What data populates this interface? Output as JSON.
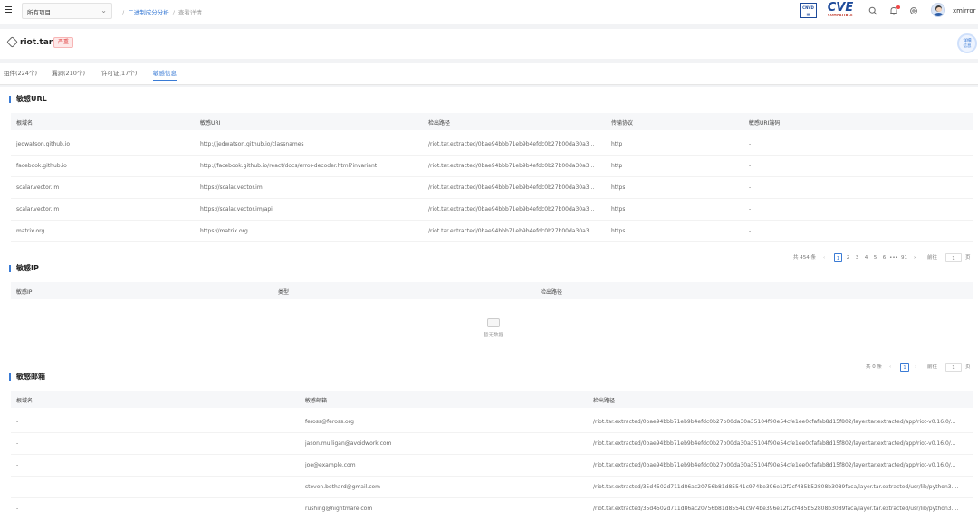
{
  "topbar": {
    "project_select": "所有项目",
    "breadcrumb": [
      "二进制成分分析",
      "查看详情"
    ],
    "logo_cnvd_text": "CNVD",
    "logo_cve_text": "CVE",
    "logo_cve_sub": "COMPATIBLE",
    "username": "xmirror"
  },
  "header": {
    "package_name": "riot.tar",
    "severity": "严重",
    "detail_button": [
      "详细",
      "信息"
    ]
  },
  "tabs": [
    {
      "label": "组件(224个)",
      "active": false
    },
    {
      "label": "漏洞(210个)",
      "active": false
    },
    {
      "label": "许可证(17个)",
      "active": false
    },
    {
      "label": "敏感信息",
      "active": true
    }
  ],
  "sensitive_url": {
    "title": "敏感URL",
    "columns": [
      "根域名",
      "敏感URI",
      "检出路径",
      "传输协议",
      "敏感URI端码"
    ],
    "rows": [
      [
        "jedwatson.github.io",
        "http://jedwatson.github.io/classnames",
        "/riot.tar.extracted/0bae94bbb71eb9b4efdc0b27b00da30a3...",
        "http",
        "-"
      ],
      [
        "facebook.github.io",
        "http://facebook.github.io/react/docs/error-decoder.html?invariant",
        "/riot.tar.extracted/0bae94bbb71eb9b4efdc0b27b00da30a3...",
        "http",
        "-"
      ],
      [
        "scalar.vector.im",
        "https://scalar.vector.im",
        "/riot.tar.extracted/0bae94bbb71eb9b4efdc0b27b00da30a3...",
        "https",
        "-"
      ],
      [
        "scalar.vector.im",
        "https://scalar.vector.im/api",
        "/riot.tar.extracted/0bae94bbb71eb9b4efdc0b27b00da30a3...",
        "https",
        "-"
      ],
      [
        "matrix.org",
        "https://matrix.org",
        "/riot.tar.extracted/0bae94bbb71eb9b4efdc0b27b00da30a3...",
        "https",
        "-"
      ]
    ],
    "pager": {
      "total": "共 454 条",
      "pages": [
        "1",
        "2",
        "3",
        "4",
        "5",
        "6",
        "•••",
        "91"
      ],
      "goto_label": "前往",
      "goto_value": "1",
      "page_unit": "页"
    }
  },
  "sensitive_ip": {
    "title": "敏感IP",
    "columns": [
      "敏感IP",
      "类型",
      "检出路径"
    ],
    "empty_text": "暂无数据",
    "pager": {
      "total": "共 0 条",
      "current": "1",
      "goto_label": "前往",
      "goto_value": "1",
      "page_unit": "页"
    }
  },
  "sensitive_email": {
    "title": "敏感邮箱",
    "columns": [
      "根域名",
      "敏感邮箱",
      "检出路径"
    ],
    "rows": [
      [
        "-",
        "feross@feross.org",
        "/riot.tar.extracted/0bae94bbb71eb9b4efdc0b27b00da30a35104f90e54cfe1ee0cfafab8d15f802/layer.tar.extracted/app/riot-v0.16.0/..."
      ],
      [
        "-",
        "jason.mulligan@avoidwork.com",
        "/riot.tar.extracted/0bae94bbb71eb9b4efdc0b27b00da30a35104f90e54cfe1ee0cfafab8d15f802/layer.tar.extracted/app/riot-v0.16.0/..."
      ],
      [
        "-",
        "joe@example.com",
        "/riot.tar.extracted/0bae94bbb71eb9b4efdc0b27b00da30a35104f90e54cfe1ee0cfafab8d15f802/layer.tar.extracted/app/riot-v0.16.0/..."
      ],
      [
        "-",
        "steven.bethard@gmail.com",
        "/riot.tar.extracted/35d4502d711d86ac20756b81d85541c974be396e12f2cf485b52808b3089faca/layer.tar.extracted/usr/lib/python3...."
      ],
      [
        "-",
        "rushing@nightmare.com",
        "/riot.tar.extracted/35d4502d711d86ac20756b81d85541c974be396e12f2cf485b52808b3089faca/layer.tar.extracted/usr/lib/python3...."
      ]
    ]
  }
}
